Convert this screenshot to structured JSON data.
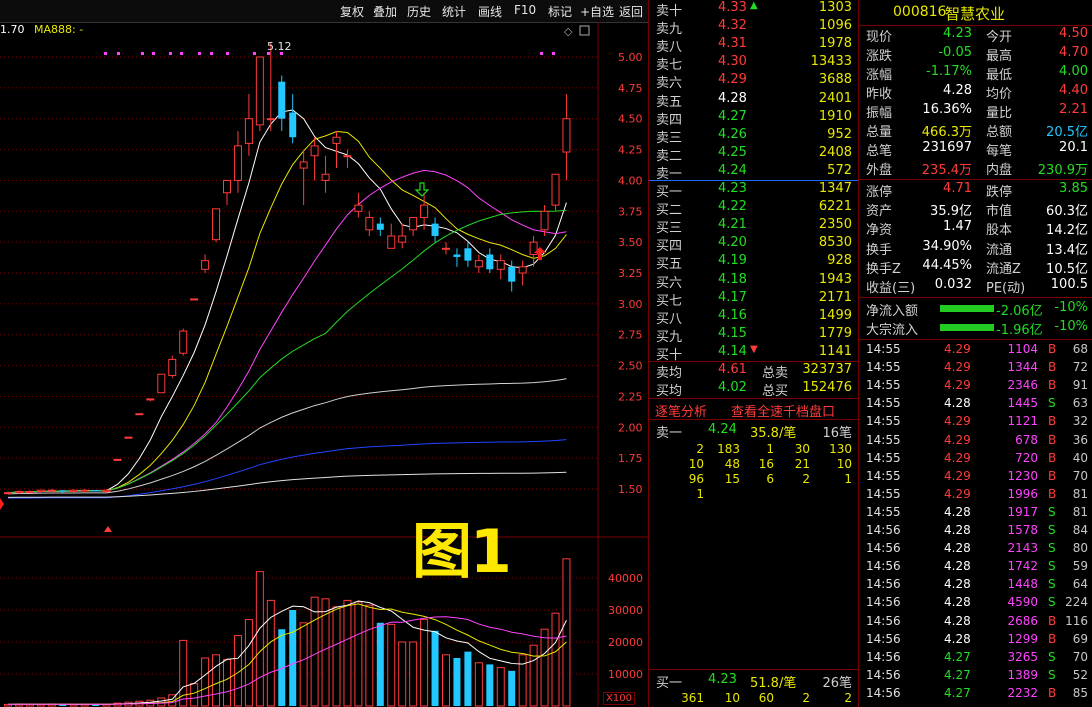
{
  "toolbar": {
    "buttons": [
      "复权",
      "叠加",
      "历史",
      "统计",
      "画线",
      "F10",
      "标记",
      "+自选",
      "返回"
    ],
    "ma_label_left": "1.70",
    "ma_label": "MA888: -",
    "peak_label": "5.12"
  },
  "figure_label": "图1",
  "price_axis": [
    "5.00",
    "4.75",
    "4.50",
    "4.25",
    "4.00",
    "3.75",
    "3.50",
    "3.25",
    "3.00",
    "2.75",
    "2.50",
    "2.25",
    "2.00",
    "1.75",
    "1.50"
  ],
  "volume_axis": [
    "40000",
    "30000",
    "20000",
    "10000"
  ],
  "volume_unit": "X100",
  "chart_data": {
    "type": "candlestick",
    "candles": [
      [
        1.47,
        1.48,
        1.46,
        1.47
      ],
      [
        1.47,
        1.49,
        1.46,
        1.48
      ],
      [
        1.48,
        1.49,
        1.47,
        1.48
      ],
      [
        1.48,
        1.49,
        1.47,
        1.49
      ],
      [
        1.49,
        1.5,
        1.48,
        1.49
      ],
      [
        1.49,
        1.49,
        1.47,
        1.48
      ],
      [
        1.48,
        1.5,
        1.47,
        1.49
      ],
      [
        1.49,
        1.5,
        1.48,
        1.49
      ],
      [
        1.49,
        1.49,
        1.48,
        1.48
      ],
      [
        1.48,
        1.5,
        1.47,
        1.49
      ],
      [
        1.74,
        1.74,
        1.74,
        1.74
      ],
      [
        1.92,
        1.92,
        1.92,
        1.92
      ],
      [
        2.11,
        2.11,
        2.11,
        2.11
      ],
      [
        2.23,
        2.23,
        2.21,
        2.23
      ],
      [
        2.28,
        2.43,
        2.28,
        2.43
      ],
      [
        2.42,
        2.58,
        2.4,
        2.55
      ],
      [
        2.6,
        2.8,
        2.58,
        2.78
      ],
      [
        3.04,
        3.04,
        3.04,
        3.04
      ],
      [
        3.28,
        3.4,
        3.25,
        3.35
      ],
      [
        3.52,
        3.77,
        3.5,
        3.77
      ],
      [
        3.9,
        4.0,
        3.8,
        4.0
      ],
      [
        4.0,
        4.4,
        3.9,
        4.28
      ],
      [
        4.3,
        4.7,
        4.2,
        4.5
      ],
      [
        4.45,
        5.0,
        4.4,
        5.0
      ],
      [
        4.5,
        5.12,
        4.4,
        4.5
      ],
      [
        4.8,
        4.85,
        4.4,
        4.5
      ],
      [
        4.55,
        4.7,
        4.3,
        4.35
      ],
      [
        4.1,
        4.25,
        3.8,
        4.15
      ],
      [
        4.2,
        4.35,
        4.0,
        4.28
      ],
      [
        4.0,
        4.2,
        3.9,
        4.05
      ],
      [
        4.3,
        4.4,
        4.1,
        4.35
      ],
      [
        4.2,
        4.25,
        4.1,
        4.2
      ],
      [
        3.75,
        3.9,
        3.7,
        3.8
      ],
      [
        3.6,
        3.75,
        3.55,
        3.7
      ],
      [
        3.65,
        3.7,
        3.55,
        3.6
      ],
      [
        3.45,
        3.65,
        3.45,
        3.55
      ],
      [
        3.5,
        3.65,
        3.45,
        3.55
      ],
      [
        3.6,
        3.7,
        3.55,
        3.7
      ],
      [
        3.7,
        3.9,
        3.6,
        3.8
      ],
      [
        3.65,
        3.7,
        3.5,
        3.55
      ],
      [
        3.45,
        3.5,
        3.4,
        3.45
      ],
      [
        3.4,
        3.45,
        3.3,
        3.38
      ],
      [
        3.45,
        3.5,
        3.3,
        3.35
      ],
      [
        3.3,
        3.4,
        3.25,
        3.35
      ],
      [
        3.4,
        3.45,
        3.25,
        3.28
      ],
      [
        3.28,
        3.4,
        3.2,
        3.35
      ],
      [
        3.3,
        3.35,
        3.1,
        3.18
      ],
      [
        3.25,
        3.35,
        3.15,
        3.3
      ],
      [
        3.4,
        3.55,
        3.3,
        3.5
      ],
      [
        3.6,
        3.8,
        3.55,
        3.75
      ],
      [
        3.8,
        4.05,
        3.75,
        4.05
      ],
      [
        4.23,
        4.7,
        4.0,
        4.5
      ]
    ],
    "volumes": [
      500,
      600,
      550,
      500,
      600,
      450,
      500,
      550,
      600,
      500,
      900,
      1200,
      1500,
      1800,
      2500,
      3500,
      20500,
      7000,
      15000,
      16000,
      14500,
      22000,
      27000,
      42000,
      33000,
      24000,
      30000,
      26000,
      34000,
      33500,
      31000,
      33000,
      32500,
      31500,
      26000,
      25500,
      20000,
      20000,
      27000,
      23500,
      16000,
      15000,
      17000,
      13500,
      13000,
      12000,
      11000,
      16000,
      19000,
      24000,
      29000,
      46000
    ]
  },
  "order_book": {
    "asks": [
      {
        "label": "卖十",
        "price": "4.33",
        "vol": "1303",
        "mark": "up"
      },
      {
        "label": "卖九",
        "price": "4.32",
        "vol": "1096"
      },
      {
        "label": "卖八",
        "price": "4.31",
        "vol": "1978"
      },
      {
        "label": "卖七",
        "price": "4.30",
        "vol": "13433"
      },
      {
        "label": "卖六",
        "price": "4.29",
        "vol": "3688"
      },
      {
        "label": "卖五",
        "price": "4.28",
        "vol": "2401"
      },
      {
        "label": "卖四",
        "price": "4.27",
        "vol": "1910"
      },
      {
        "label": "卖三",
        "price": "4.26",
        "vol": "952"
      },
      {
        "label": "卖二",
        "price": "4.25",
        "vol": "2408"
      },
      {
        "label": "卖一",
        "price": "4.24",
        "vol": "572"
      }
    ],
    "bids": [
      {
        "label": "买一",
        "price": "4.23",
        "vol": "1347"
      },
      {
        "label": "买二",
        "price": "4.22",
        "vol": "6221"
      },
      {
        "label": "买三",
        "price": "4.21",
        "vol": "2350"
      },
      {
        "label": "买四",
        "price": "4.20",
        "vol": "8530"
      },
      {
        "label": "买五",
        "price": "4.19",
        "vol": "928"
      },
      {
        "label": "买六",
        "price": "4.18",
        "vol": "1943"
      },
      {
        "label": "买七",
        "price": "4.17",
        "vol": "2171"
      },
      {
        "label": "买八",
        "price": "4.16",
        "vol": "1499"
      },
      {
        "label": "买九",
        "price": "4.15",
        "vol": "1779"
      },
      {
        "label": "买十",
        "price": "4.14",
        "vol": "1141",
        "mark": "down"
      }
    ],
    "summary": [
      {
        "l1": "卖均",
        "v1": "4.61",
        "l2": "总卖",
        "v2": "323737"
      },
      {
        "l1": "买均",
        "v1": "4.02",
        "l2": "总买",
        "v2": "152476"
      }
    ],
    "tabs": [
      "逐笔分析",
      "查看全速千档盘口"
    ],
    "queue": {
      "head": {
        "label": "卖一",
        "price": "4.24",
        "avg": "35.8/笔",
        "count": "16笔"
      },
      "rows": [
        [
          "2",
          "183",
          "1",
          "30",
          "130"
        ],
        [
          "10",
          "48",
          "16",
          "21",
          "10"
        ],
        [
          "96",
          "15",
          "6",
          "2",
          "1"
        ],
        [
          "1"
        ]
      ]
    },
    "bid_queue": {
      "head": {
        "label": "买一",
        "price": "4.23",
        "avg": "51.8/笔",
        "count": "26笔"
      },
      "rows": [
        [
          "361",
          "10",
          "60",
          "2",
          "2"
        ]
      ]
    }
  },
  "stock": {
    "code": "000816",
    "name": "智慧农业"
  },
  "quote": [
    {
      "l1": "现价",
      "v1": "4.23",
      "c1": "green",
      "l2": "今开",
      "v2": "4.50",
      "c2": "red"
    },
    {
      "l1": "涨跌",
      "v1": "-0.05",
      "c1": "green",
      "l2": "最高",
      "v2": "4.70",
      "c2": "red"
    },
    {
      "l1": "涨幅",
      "v1": "-1.17%",
      "c1": "green",
      "l2": "最低",
      "v2": "4.00",
      "c2": "green"
    },
    {
      "l1": "昨收",
      "v1": "4.28",
      "c1": "white",
      "l2": "均价",
      "v2": "4.40",
      "c2": "red"
    },
    {
      "l1": "振幅",
      "v1": "16.36%",
      "c1": "white",
      "l2": "量比",
      "v2": "2.21",
      "c2": "red"
    },
    {
      "l1": "总量",
      "v1": "466.3万",
      "c1": "yellow",
      "l2": "总额",
      "v2": "20.5亿",
      "c2": "cyan"
    },
    {
      "l1": "总笔",
      "v1": "231697",
      "c1": "white",
      "l2": "每笔",
      "v2": "20.1",
      "c2": "white"
    },
    {
      "l1": "外盘",
      "v1": "235.4万",
      "c1": "red",
      "l2": "内盘",
      "v2": "230.9万",
      "c2": "green"
    }
  ],
  "quote2": [
    {
      "l1": "涨停",
      "v1": "4.71",
      "c1": "red",
      "l2": "跌停",
      "v2": "3.85",
      "c2": "green"
    },
    {
      "l1": "资产",
      "v1": "35.9亿",
      "c1": "white",
      "l2": "市值",
      "v2": "60.3亿",
      "c2": "white"
    },
    {
      "l1": "净资",
      "v1": "1.47",
      "c1": "white",
      "l2": "股本",
      "v2": "14.2亿",
      "c2": "white"
    },
    {
      "l1": "换手",
      "v1": "34.90%",
      "c1": "white",
      "l2": "流通",
      "v2": "13.4亿",
      "c2": "white"
    },
    {
      "l1": "换手Z",
      "v1": "44.45%",
      "c1": "white",
      "l2": "流通Z",
      "v2": "10.5亿",
      "c2": "white"
    },
    {
      "l1": "收益(三)",
      "v1": "0.032",
      "c1": "white",
      "l2": "PE(动)",
      "v2": "100.5",
      "c2": "white"
    }
  ],
  "flows": [
    {
      "label": "净流入额",
      "value": "-2.06亿",
      "pct": "-10%"
    },
    {
      "label": "大宗流入",
      "value": "-1.96亿",
      "pct": "-10%"
    }
  ],
  "ticks": [
    {
      "t": "14:55",
      "p": "4.29",
      "pc": "red",
      "v": "1104",
      "s": "B",
      "n": "68"
    },
    {
      "t": "14:55",
      "p": "4.29",
      "pc": "red",
      "v": "1344",
      "s": "B",
      "n": "72"
    },
    {
      "t": "14:55",
      "p": "4.29",
      "pc": "red",
      "v": "2346",
      "s": "B",
      "n": "91"
    },
    {
      "t": "14:55",
      "p": "4.28",
      "pc": "white",
      "v": "1445",
      "s": "S",
      "n": "63"
    },
    {
      "t": "14:55",
      "p": "4.29",
      "pc": "red",
      "v": "1121",
      "s": "B",
      "n": "32"
    },
    {
      "t": "14:55",
      "p": "4.29",
      "pc": "red",
      "v": "678",
      "s": "B",
      "n": "36"
    },
    {
      "t": "14:55",
      "p": "4.29",
      "pc": "red",
      "v": "720",
      "s": "B",
      "n": "40"
    },
    {
      "t": "14:55",
      "p": "4.29",
      "pc": "red",
      "v": "1230",
      "s": "B",
      "n": "70"
    },
    {
      "t": "14:55",
      "p": "4.29",
      "pc": "red",
      "v": "1996",
      "s": "B",
      "n": "81"
    },
    {
      "t": "14:55",
      "p": "4.28",
      "pc": "white",
      "v": "1917",
      "s": "S",
      "n": "81"
    },
    {
      "t": "14:56",
      "p": "4.28",
      "pc": "white",
      "v": "1578",
      "s": "S",
      "n": "84"
    },
    {
      "t": "14:56",
      "p": "4.28",
      "pc": "white",
      "v": "2143",
      "s": "S",
      "n": "80"
    },
    {
      "t": "14:56",
      "p": "4.28",
      "pc": "white",
      "v": "1742",
      "s": "S",
      "n": "59"
    },
    {
      "t": "14:56",
      "p": "4.28",
      "pc": "white",
      "v": "1448",
      "s": "S",
      "n": "64"
    },
    {
      "t": "14:56",
      "p": "4.28",
      "pc": "white",
      "v": "4590",
      "s": "S",
      "n": "224"
    },
    {
      "t": "14:56",
      "p": "4.28",
      "pc": "white",
      "v": "2686",
      "s": "B",
      "n": "116"
    },
    {
      "t": "14:56",
      "p": "4.28",
      "pc": "white",
      "v": "1299",
      "s": "B",
      "n": "69"
    },
    {
      "t": "14:56",
      "p": "4.27",
      "pc": "green",
      "v": "3265",
      "s": "S",
      "n": "70"
    },
    {
      "t": "14:56",
      "p": "4.27",
      "pc": "green",
      "v": "1389",
      "s": "S",
      "n": "52"
    },
    {
      "t": "14:56",
      "p": "4.27",
      "pc": "green",
      "v": "2232",
      "s": "B",
      "n": "85"
    }
  ],
  "colors": {
    "up": "#ff3b3b",
    "down": "#22c8ff",
    "ma5": "#ffffff",
    "ma10": "#e8e800",
    "ma20": "#ff44ff",
    "ma60": "#22dd22",
    "ma120": "#d0d0d0",
    "ma250": "#2244ff",
    "grid": "#7a0000",
    "flow_bar": "#22cc22"
  }
}
